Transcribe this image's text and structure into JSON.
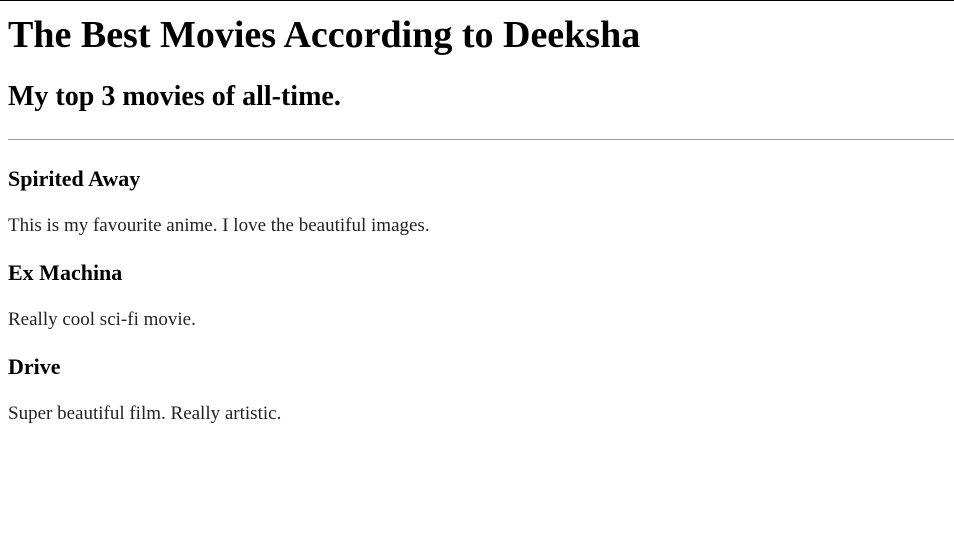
{
  "page": {
    "title": "The Best Movies According to Deeksha",
    "subtitle": "My top 3 movies of all-time."
  },
  "movies": [
    {
      "name": "Spirited Away",
      "description": "This is my favourite anime. I love the beautiful images."
    },
    {
      "name": "Ex Machina",
      "description": "Really cool sci-fi movie."
    },
    {
      "name": "Drive",
      "description": "Super beautiful film. Really artistic."
    }
  ]
}
